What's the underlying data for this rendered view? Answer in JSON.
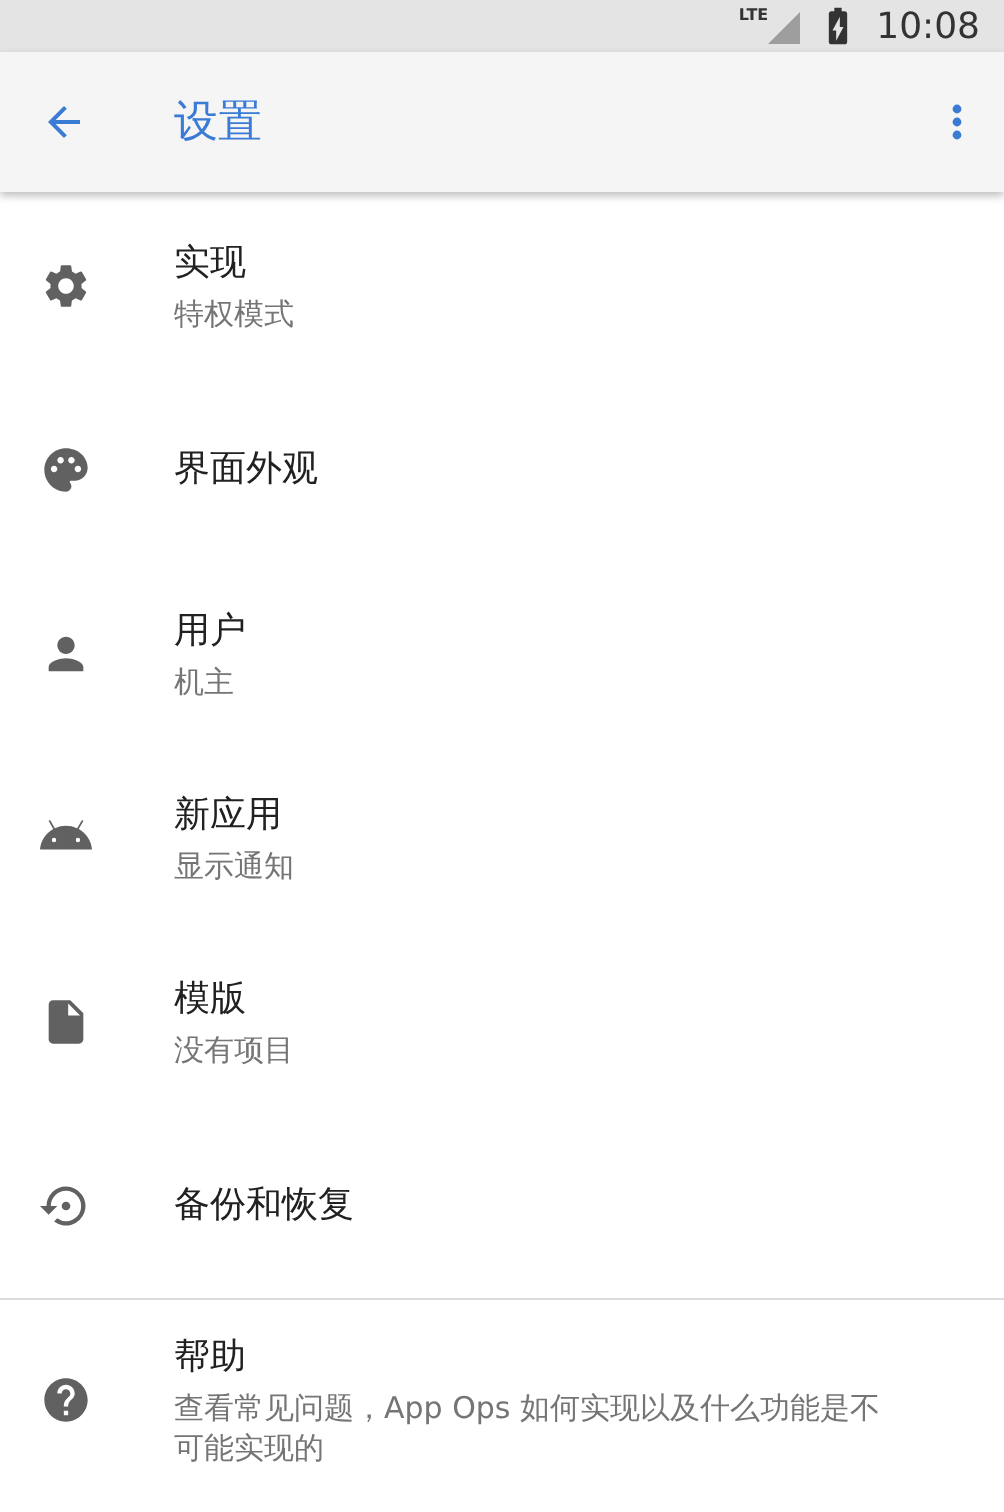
{
  "status_bar": {
    "network": "LTE",
    "time": "10:08"
  },
  "app_bar": {
    "title": "设置"
  },
  "sections": [
    {
      "items": [
        {
          "title": "实现",
          "subtitle": "特权模式"
        },
        {
          "title": "界面外观"
        },
        {
          "title": "用户",
          "subtitle": "机主"
        },
        {
          "title": "新应用",
          "subtitle": "显示通知"
        },
        {
          "title": "模版",
          "subtitle": "没有项目"
        },
        {
          "title": "备份和恢复"
        }
      ]
    },
    {
      "items": [
        {
          "title": "帮助",
          "subtitle": "查看常见问题，App Ops 如何实现以及什么功能是不可能实现的"
        }
      ]
    }
  ]
}
